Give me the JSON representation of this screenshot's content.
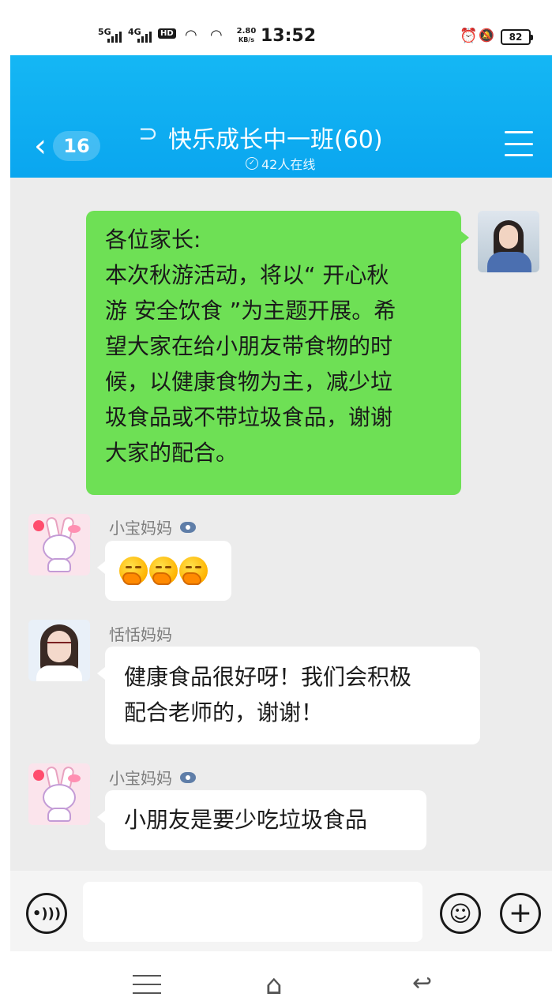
{
  "status_bar": {
    "network1": "5G",
    "network2": "4G",
    "hd": "HD",
    "speed_value": "2.80",
    "speed_unit": "KB/s",
    "time": "13:52",
    "battery": "82"
  },
  "header": {
    "unread_count": "16",
    "title": "快乐成长中一班(60)",
    "online_status": "42人在线"
  },
  "messages": [
    {
      "sender": "self",
      "lines": [
        "各位家长:",
        "本次秋游活动，将以“ 开心秋",
        "游  安全饮食 ”为主题开展。希",
        "望大家在给小朋友带食物的时",
        "候，以健康食物为主，减少垃",
        "圾食品或不带垃圾食品，谢谢",
        "大家的配合。"
      ]
    },
    {
      "sender": "小宝妈妈",
      "emoji_count": 3,
      "emoji": "hugging-face"
    },
    {
      "sender": "恬恬妈妈",
      "lines": [
        "健康食品很好呀！我们会积极",
        "配合老师的，谢谢！"
      ]
    },
    {
      "sender": "小宝妈妈",
      "text": "小朋友是要少吃垃圾食品"
    }
  ],
  "input_bar": {
    "placeholder": ""
  },
  "colors": {
    "header_bg": "#0aa6ef",
    "self_bubble": "#6ee055",
    "chat_bg": "#ececec"
  }
}
